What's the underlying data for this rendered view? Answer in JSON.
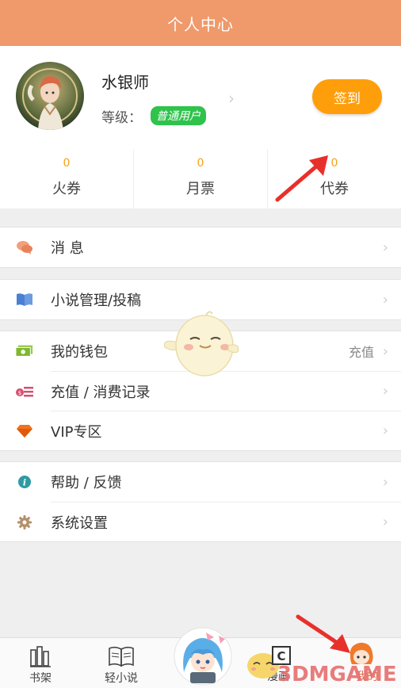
{
  "header": {
    "title": "个人中心"
  },
  "profile": {
    "username": "水银师",
    "level_label": "等级：",
    "level_badge": "普通用户",
    "signin_label": "签到"
  },
  "stats": [
    {
      "value": "0",
      "label": "火券"
    },
    {
      "value": "0",
      "label": "月票"
    },
    {
      "value": "0",
      "label": "代券"
    }
  ],
  "menu": {
    "messages": "消 息",
    "novel_manage": "小说管理/投稿",
    "wallet": "我的钱包",
    "wallet_right": "充值",
    "recharge_records": "充值 / 消费记录",
    "vip": "VIP专区",
    "help": "帮助 / 反馈",
    "settings": "系统设置"
  },
  "tabbar": {
    "bookshelf": "书架",
    "light_novel": "轻小说",
    "comic": "漫画",
    "me": "我的"
  },
  "watermark": "3DMGAME",
  "colors": {
    "header": "#f0996a",
    "signin": "#ff9e0b",
    "badge": "#2fc34b",
    "stat_value": "#f6a01a",
    "arrow": "#e8302a"
  }
}
